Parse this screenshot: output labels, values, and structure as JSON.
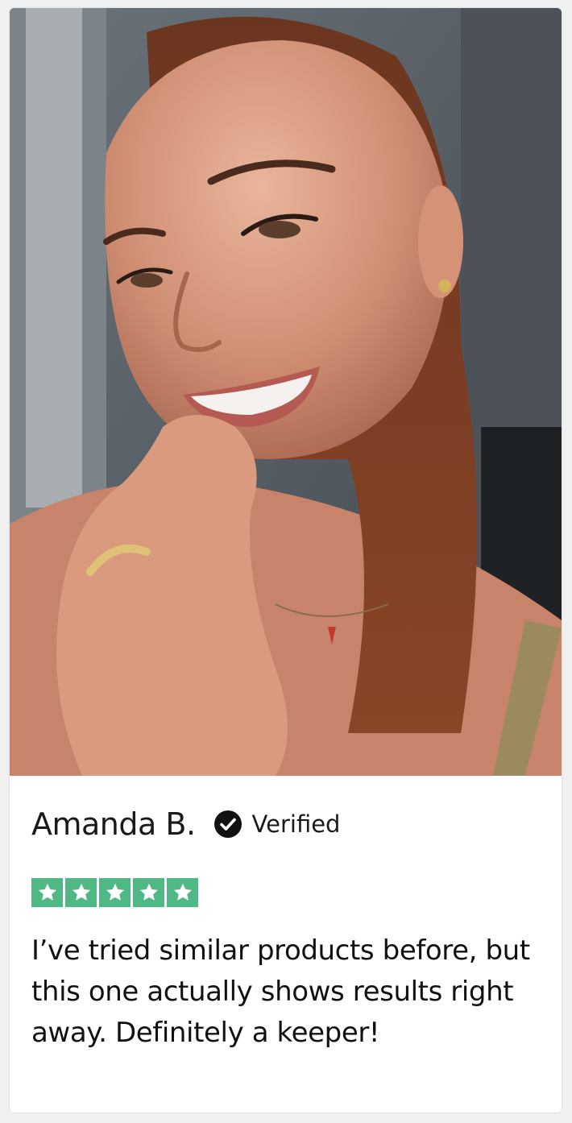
{
  "review": {
    "reviewer_name": "Amanda B.",
    "verified_label": "Verified",
    "rating": 5,
    "rating_max": 5,
    "star_color": "#4fb885",
    "text": "I’ve tried similar products before, but this one actually shows results right away. Definitely a keeper!",
    "icons": {
      "verified": "check-circle-icon",
      "star": "star-icon"
    }
  }
}
